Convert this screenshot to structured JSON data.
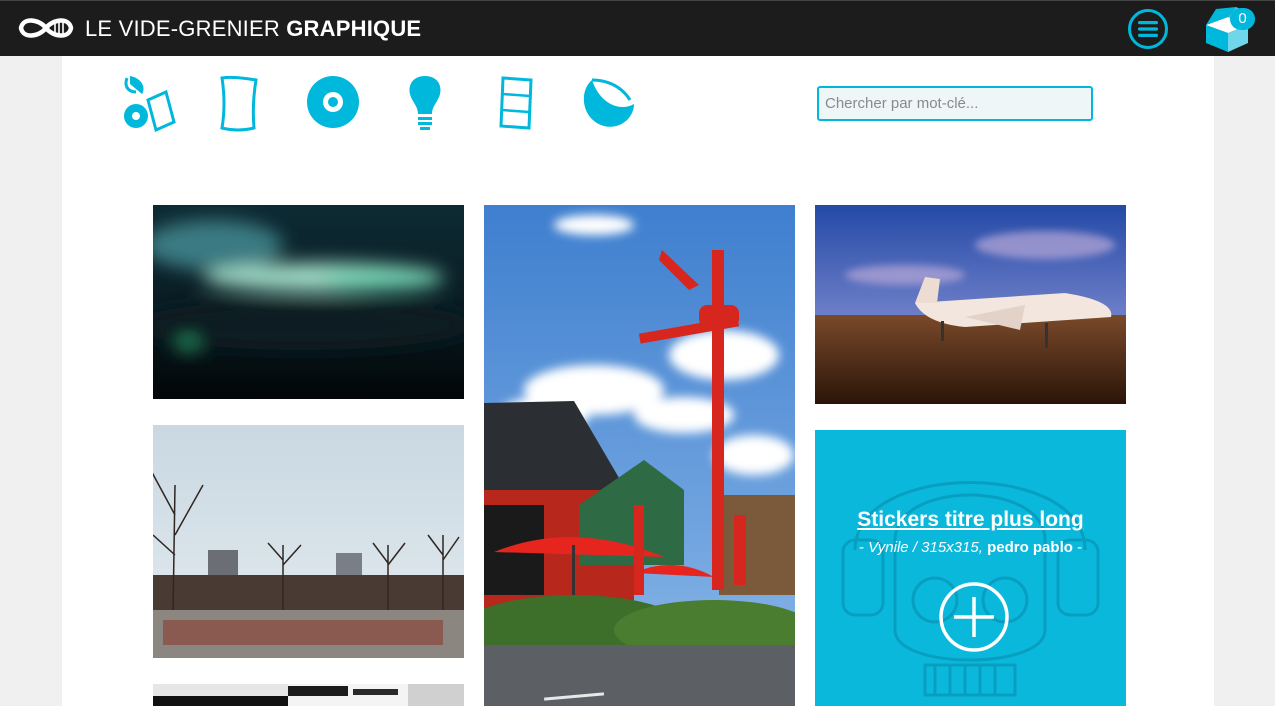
{
  "header": {
    "brand_light": "LE VIDE-GRENIER",
    "brand_bold": "GRAPHIQUE",
    "logo_icon": "infinity-logo-icon",
    "menu_icon": "hamburger-circle-icon",
    "cart_icon": "open-box-icon",
    "cart_count": "0"
  },
  "categories": [
    {
      "name": "mixed-shapes-category",
      "icon": "stickers-icon"
    },
    {
      "name": "poster-category",
      "icon": "sheet-icon"
    },
    {
      "name": "vinyl-category",
      "icon": "disc-icon"
    },
    {
      "name": "idea-category",
      "icon": "lightbulb-icon"
    },
    {
      "name": "leaflet-category",
      "icon": "folded-sheet-icon"
    },
    {
      "name": "round-sticker-category",
      "icon": "peeling-circle-icon"
    }
  ],
  "search": {
    "placeholder": "Chercher par mot-clé..."
  },
  "feature": {
    "title": "Stickers titre plus long",
    "sub_prefix": "- Vynile / 315x315,",
    "sub_author": "pedro pablo",
    "sub_suffix": "-",
    "action_icon": "plus-circle-icon"
  },
  "colors": {
    "accent": "#00b8dc",
    "header_bg": "#1c1c1c",
    "page_bg": "#f0f0f0",
    "panel_bg": "#ffffff"
  },
  "gallery": [
    {
      "name": "aurora-photo",
      "subject": "blurred teal night sky"
    },
    {
      "name": "red-tower-photo",
      "subject": "red tower and parasols"
    },
    {
      "name": "jet-photo",
      "subject": "private jet at dusk"
    },
    {
      "name": "park-photo",
      "subject": "winter park with bare trees"
    },
    {
      "name": "band-photo",
      "subject": "black and white poster"
    }
  ]
}
